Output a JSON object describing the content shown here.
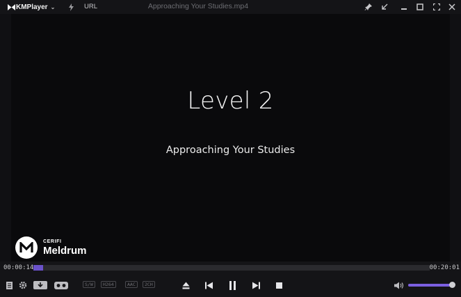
{
  "titlebar": {
    "app_name": "KMPlayer",
    "url_label": "URL",
    "window_title": "Approaching Your Studies.mp4"
  },
  "video": {
    "title": "Level 2",
    "subtitle": "Approaching Your Studies",
    "brand_small": "CERIFI",
    "brand_name": "Meldrum"
  },
  "playback": {
    "current_time": "00:00:14",
    "total_time": "00:20:01",
    "progress_fraction": 0.012
  },
  "badges": [
    "S/W",
    "H264",
    "AAC",
    "2CH"
  ],
  "volume": {
    "level_fraction": 0.98
  },
  "colors": {
    "accent": "#6a52c9",
    "background": "#0a0a0c",
    "chrome": "#141417"
  }
}
